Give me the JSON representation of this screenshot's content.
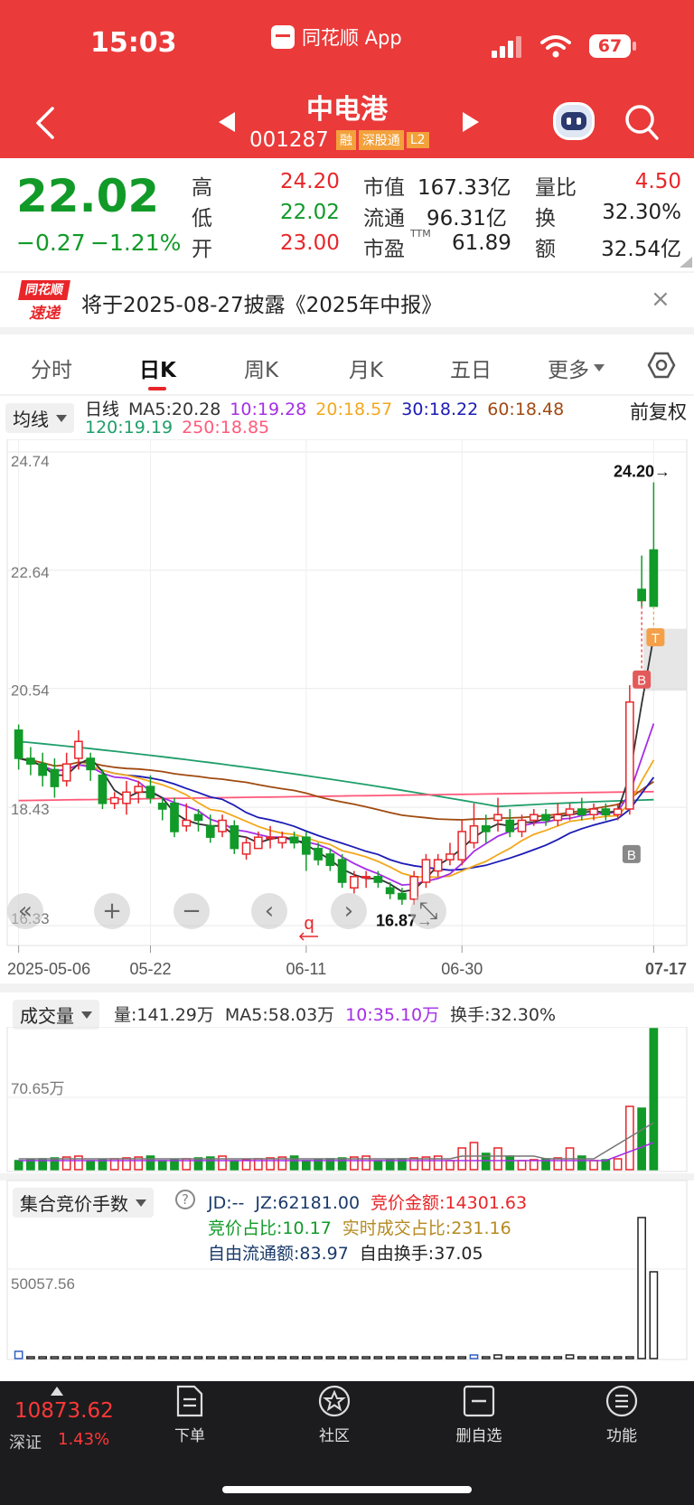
{
  "status_bar": {
    "time": "15:03",
    "app": "同花顺 App",
    "battery": "67"
  },
  "header": {
    "name": "中电港",
    "code": "001287",
    "badges": [
      "融",
      "深股通",
      "L2"
    ]
  },
  "quote": {
    "price": "22.02",
    "change": "−0.27",
    "change_pct": "−1.21%",
    "rows": [
      {
        "l1": "高",
        "v1": "24.20",
        "l2": "市值",
        "v2": "167.33亿",
        "l3": "量比",
        "v3": "4.50"
      },
      {
        "l1": "低",
        "v1": "22.02",
        "l2": "流通",
        "v2": "96.31亿",
        "l3": "换",
        "v3": "32.30%"
      },
      {
        "l1": "开",
        "v1": "23.00",
        "l2": "市盈",
        "sup": "TTM",
        "v2": "61.89",
        "l3": "额",
        "v3": "32.54亿"
      }
    ]
  },
  "notice": {
    "logo_top": "同花顺",
    "logo_bottom": "速递",
    "text": "将于2025-08-27披露《2025年中报》",
    "close": "×"
  },
  "tabs": [
    "分时",
    "日K",
    "周K",
    "月K",
    "五日",
    "更多"
  ],
  "active_tab": "日K",
  "ma_bar": {
    "selector": "均线",
    "line1": [
      {
        "t": "日线",
        "c": "#222"
      },
      {
        "t": "MA5:20.28",
        "c": "#333"
      },
      {
        "t": "10:19.28",
        "c": "#a52ee6"
      },
      {
        "t": "20:18.57",
        "c": "#f2a81d"
      },
      {
        "t": "30:18.22",
        "c": "#1b1bb5"
      },
      {
        "t": "60:18.48",
        "c": "#a04a10"
      }
    ],
    "line2": [
      {
        "t": "120:19.19",
        "c": "#1f9e6a"
      },
      {
        "t": "250:18.85",
        "c": "#ff5a7a"
      }
    ],
    "adjust": "前复权"
  },
  "chart_data": {
    "type": "candlestick",
    "y_ticks": [
      "24.74",
      "22.64",
      "20.54",
      "18.43",
      "16.33"
    ],
    "ylim": [
      16.33,
      24.74
    ],
    "x_ticks": [
      "2025-05-06",
      "05-22",
      "06-11",
      "06-30",
      "07-17"
    ],
    "high_annotation": "24.20→",
    "low_annotation": "16.87→",
    "markers": [
      "B",
      "T",
      "B"
    ],
    "candles": [
      [
        19.8,
        19.3,
        19.9,
        19.1
      ],
      [
        19.3,
        19.2,
        19.5,
        19.0
      ],
      [
        19.2,
        19.0,
        19.4,
        18.8
      ],
      [
        19.1,
        18.8,
        19.3,
        18.6
      ],
      [
        18.9,
        19.2,
        19.4,
        18.8
      ],
      [
        19.3,
        19.6,
        19.8,
        19.1
      ],
      [
        19.3,
        19.1,
        19.4,
        18.9
      ],
      [
        19.0,
        18.5,
        19.1,
        18.4
      ],
      [
        18.5,
        18.6,
        18.7,
        18.4
      ],
      [
        18.5,
        18.7,
        18.9,
        18.3
      ],
      [
        18.7,
        18.8,
        18.9,
        18.5
      ],
      [
        18.8,
        18.6,
        19.0,
        18.5
      ],
      [
        18.5,
        18.4,
        18.6,
        18.2
      ],
      [
        18.5,
        18.0,
        18.6,
        17.9
      ],
      [
        18.1,
        18.2,
        18.5,
        18.0
      ],
      [
        18.3,
        18.2,
        18.4,
        18.0
      ],
      [
        18.1,
        17.9,
        18.3,
        17.8
      ],
      [
        18.0,
        18.2,
        18.3,
        17.9
      ],
      [
        18.1,
        17.7,
        18.2,
        17.6
      ],
      [
        17.6,
        17.8,
        17.9,
        17.5
      ],
      [
        17.7,
        17.9,
        18.0,
        17.7
      ],
      [
        17.9,
        17.9,
        18.1,
        17.7
      ],
      [
        17.8,
        17.9,
        18.0,
        17.7
      ],
      [
        17.9,
        17.8,
        18.0,
        17.7
      ],
      [
        17.9,
        17.6,
        18.0,
        17.3
      ],
      [
        17.7,
        17.5,
        17.8,
        17.4
      ],
      [
        17.6,
        17.4,
        17.7,
        17.3
      ],
      [
        17.5,
        17.1,
        17.6,
        17.0
      ],
      [
        17.0,
        17.2,
        17.3,
        16.9
      ],
      [
        17.2,
        17.2,
        17.3,
        17.0
      ],
      [
        17.2,
        17.1,
        17.3,
        17.0
      ],
      [
        17.0,
        16.9,
        17.1,
        16.8
      ],
      [
        16.9,
        16.8,
        17.0,
        16.7
      ],
      [
        16.8,
        17.2,
        17.3,
        16.7
      ],
      [
        17.1,
        17.5,
        17.6,
        17.0
      ],
      [
        17.3,
        17.5,
        17.6,
        17.2
      ],
      [
        17.5,
        17.6,
        17.8,
        17.4
      ],
      [
        17.5,
        18.0,
        18.2,
        17.4
      ],
      [
        17.8,
        18.1,
        18.5,
        17.7
      ],
      [
        18.1,
        18.0,
        18.3,
        17.8
      ],
      [
        18.2,
        18.3,
        18.6,
        18.0
      ],
      [
        18.2,
        18.0,
        18.4,
        17.9
      ],
      [
        18.0,
        18.2,
        18.3,
        17.9
      ],
      [
        18.2,
        18.3,
        18.4,
        18.1
      ],
      [
        18.3,
        18.2,
        18.4,
        18.1
      ],
      [
        18.2,
        18.3,
        18.5,
        18.1
      ],
      [
        18.3,
        18.4,
        18.5,
        18.2
      ],
      [
        18.4,
        18.3,
        18.6,
        18.2
      ],
      [
        18.3,
        18.4,
        18.5,
        18.2
      ],
      [
        18.4,
        18.3,
        18.5,
        18.2
      ],
      [
        18.3,
        18.4,
        18.5,
        18.2
      ],
      [
        18.4,
        20.3,
        20.6,
        18.3
      ],
      [
        22.3,
        22.1,
        22.9,
        22.0
      ],
      [
        23.0,
        22.0,
        24.2,
        22.0
      ]
    ]
  },
  "volume": {
    "selector": "成交量",
    "items": [
      {
        "t": "量:141.29万",
        "c": "#333"
      },
      {
        "t": "MA5:58.03万",
        "c": "#333"
      },
      {
        "t": "10:35.10万",
        "c": "#a52ee6"
      },
      {
        "t": "换手:32.30%",
        "c": "#333"
      }
    ],
    "y_label": "70.65万"
  },
  "auction": {
    "selector": "集合竞价手数",
    "line1": [
      {
        "t": "JD:--",
        "c": "#1a3a6a"
      },
      {
        "t": "JZ:62181.00",
        "c": "#1a3a6a"
      },
      {
        "t": "竞价金额:14301.63",
        "c": "#e8262a"
      }
    ],
    "line2": [
      {
        "t": "竞价占比:10.17",
        "c": "#119a28"
      },
      {
        "t": "实时成交占比:231.16",
        "c": "#b58a20"
      }
    ],
    "line3": [
      {
        "t": "自由流通额:83.97",
        "c": "#1a3a6a"
      },
      {
        "t": "自由换手:37.05",
        "c": "#222"
      }
    ],
    "y_label": "50057.56"
  },
  "bottom": {
    "index_value": "10873.62",
    "index_name": "深证",
    "index_pct": "1.43%",
    "nav": [
      "下单",
      "社区",
      "删自选",
      "功能"
    ]
  },
  "colors": {
    "header": "#ea3a3a",
    "up": "#e8262a",
    "down": "#119a28"
  }
}
